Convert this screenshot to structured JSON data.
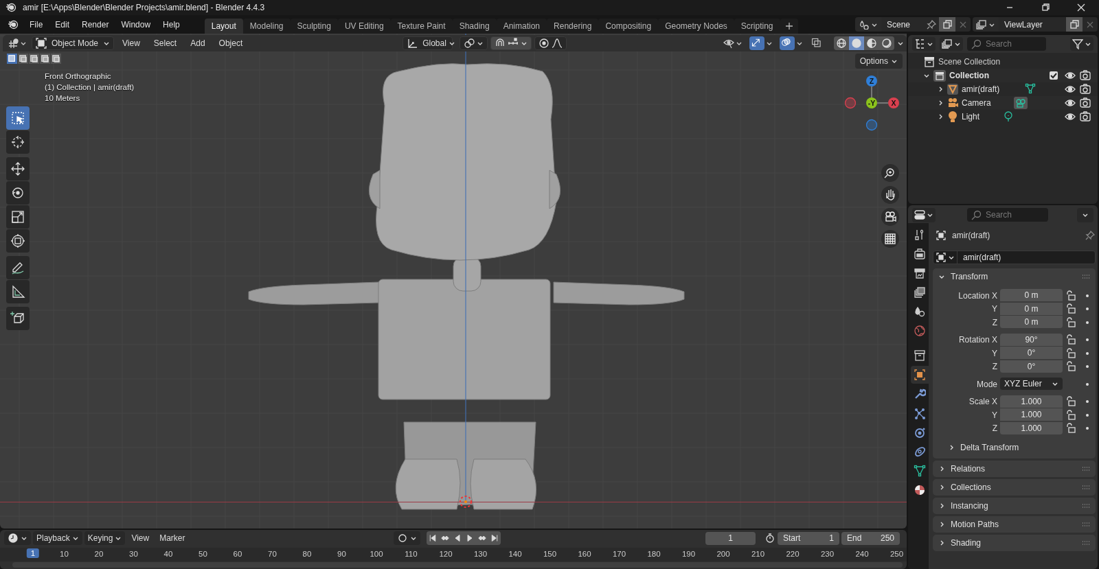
{
  "window": {
    "title": "amir [E:\\Apps\\Blender\\Blender Projects\\amir.blend] - Blender 4.4.3"
  },
  "menu": [
    "File",
    "Edit",
    "Render",
    "Window",
    "Help"
  ],
  "workspaces": [
    {
      "label": "Layout",
      "selected": true
    },
    {
      "label": "Modeling",
      "selected": false
    },
    {
      "label": "Sculpting",
      "selected": false
    },
    {
      "label": "UV Editing",
      "selected": false
    },
    {
      "label": "Texture Paint",
      "selected": false
    },
    {
      "label": "Shading",
      "selected": false
    },
    {
      "label": "Animation",
      "selected": false
    },
    {
      "label": "Rendering",
      "selected": false
    },
    {
      "label": "Compositing",
      "selected": false
    },
    {
      "label": "Geometry Nodes",
      "selected": false
    },
    {
      "label": "Scripting",
      "selected": false
    }
  ],
  "scene": {
    "name": "Scene"
  },
  "view_layer": {
    "name": "ViewLayer"
  },
  "viewport": {
    "mode": "Object Mode",
    "menus": [
      "View",
      "Select",
      "Add",
      "Object"
    ],
    "orientation": "Global",
    "toggles": [
      {
        "kind": "gizmo",
        "on": true
      },
      {
        "kind": "overlay",
        "on": true
      },
      {
        "kind": "xray",
        "on": false
      }
    ],
    "shading": [
      {
        "kind": "wireframe",
        "selected": false
      },
      {
        "kind": "solid",
        "selected": true
      },
      {
        "kind": "material",
        "selected": false
      },
      {
        "kind": "rendered",
        "selected": false
      }
    ],
    "select_modes": [
      {
        "selected": true
      },
      {
        "selected": false
      },
      {
        "selected": false
      },
      {
        "selected": false
      },
      {
        "selected": false
      }
    ],
    "proportional_edit": {
      "on": false
    },
    "options": "Options",
    "overlay_text": [
      "Front Orthographic",
      "(1) Collection | amir(draft)",
      "10 Meters"
    ],
    "tools": [
      {
        "kind": "select",
        "selected": true
      },
      {
        "kind": "cursor",
        "selected": false
      },
      {
        "kind": "move",
        "selected": false
      },
      {
        "kind": "rotate",
        "selected": false
      },
      {
        "kind": "scale",
        "selected": false
      },
      {
        "kind": "transform",
        "selected": false
      },
      {
        "kind": "annotate",
        "selected": false
      },
      {
        "kind": "measure",
        "selected": false
      },
      {
        "kind": "add-cube",
        "selected": false
      }
    ],
    "axes": [
      {
        "kind": "positive",
        "label": "Z",
        "color": "#2f7fd8"
      },
      {
        "kind": "negative",
        "color": "#d9404f"
      },
      {
        "kind": "positive",
        "label": "-Y",
        "color": "#8bc21c"
      },
      {
        "kind": "positive",
        "label": "X",
        "color": "#d9404f"
      },
      {
        "kind": "negative",
        "color": "#2f7fd8"
      }
    ]
  },
  "outliner": {
    "search_placeholder": "Search",
    "root": "Scene Collection",
    "items": [
      {
        "label": "Collection",
        "expanded": true,
        "checked": true,
        "children": [
          {
            "label": "amir(draft)",
            "kind": "mesh",
            "expanded": false
          },
          {
            "label": "Camera",
            "kind": "camera",
            "expanded": false
          },
          {
            "label": "Light",
            "kind": "light",
            "expanded": false
          }
        ]
      }
    ]
  },
  "properties": {
    "search_placeholder": "Search",
    "tabs": [
      {
        "kind": "tool",
        "selected": false
      },
      {
        "kind": "render",
        "selected": false
      },
      {
        "kind": "output",
        "selected": false
      },
      {
        "kind": "view-layer",
        "selected": false
      },
      {
        "kind": "scene",
        "selected": false
      },
      {
        "kind": "world",
        "selected": false
      },
      {
        "kind": "collection",
        "selected": false
      },
      {
        "kind": "object",
        "selected": true
      },
      {
        "kind": "modifiers",
        "selected": false
      },
      {
        "kind": "particles",
        "selected": false
      },
      {
        "kind": "physics",
        "selected": false
      },
      {
        "kind": "constraints",
        "selected": false
      },
      {
        "kind": "data",
        "selected": false
      },
      {
        "kind": "material",
        "selected": false
      }
    ],
    "object_name": "amir(draft)",
    "name_field": "amir(draft)",
    "transform": {
      "title": "Transform",
      "expanded": true,
      "groups": [
        [
          {
            "label": "Location X",
            "value": "0 m"
          },
          {
            "label": "Y",
            "value": "0 m"
          },
          {
            "label": "Z",
            "value": "0 m"
          }
        ],
        [
          {
            "label": "Rotation X",
            "value": "90°"
          },
          {
            "label": "Y",
            "value": "0°"
          },
          {
            "label": "Z",
            "value": "0°"
          }
        ]
      ],
      "mode": {
        "label": "Mode",
        "value": "XYZ Euler"
      },
      "scale": [
        {
          "label": "Scale X",
          "value": "1.000"
        },
        {
          "label": "Y",
          "value": "1.000"
        },
        {
          "label": "Z",
          "value": "1.000"
        }
      ],
      "delta": {
        "label": "Delta Transform",
        "expanded": false
      }
    },
    "panels": [
      {
        "label": "Relations",
        "expanded": false
      },
      {
        "label": "Collections",
        "expanded": false
      },
      {
        "label": "Instancing",
        "expanded": false
      },
      {
        "label": "Motion Paths",
        "expanded": false
      },
      {
        "label": "Shading",
        "expanded": false
      }
    ]
  },
  "timeline": {
    "menus": [
      "Playback",
      "Keying",
      "View",
      "Marker"
    ],
    "auto_keying": {
      "on": false
    },
    "current_frame": "1",
    "start": {
      "label": "Start",
      "value": "1"
    },
    "end": {
      "label": "End",
      "value": "250"
    },
    "playhead": "1",
    "ruler": [
      "10",
      "20",
      "30",
      "40",
      "50",
      "60",
      "70",
      "80",
      "90",
      "100",
      "110",
      "120",
      "130",
      "140",
      "150",
      "160",
      "170",
      "180",
      "190",
      "200",
      "210",
      "220",
      "230",
      "240",
      "250"
    ]
  }
}
